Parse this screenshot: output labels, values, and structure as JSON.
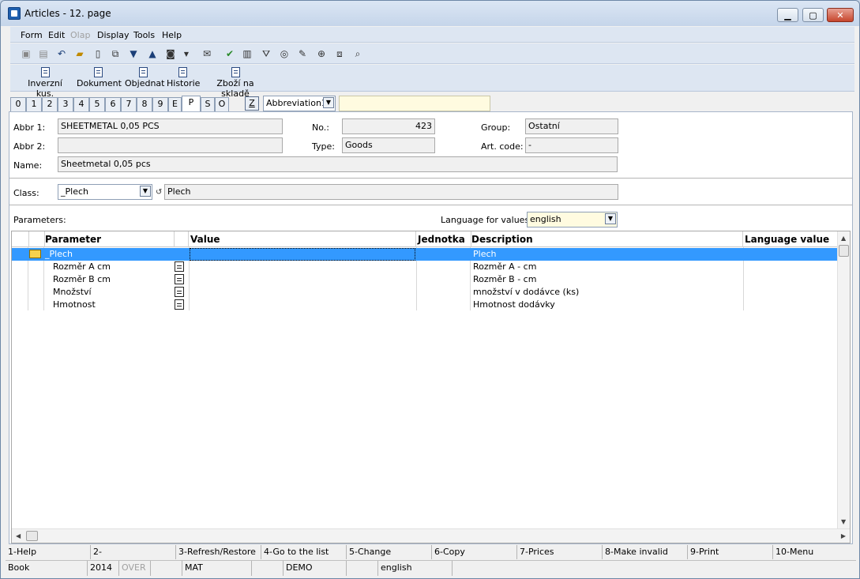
{
  "window": {
    "title": "Articles - 12. page"
  },
  "menu": [
    "Form",
    "Edit",
    "Olap",
    "Display",
    "Tools",
    "Help"
  ],
  "menu_disabled": [
    "Olap"
  ],
  "toolbar_buttons": [
    "Inverzní kus.",
    "Dokument",
    "Objednat",
    "Historie",
    "Zboží na skladě"
  ],
  "tabs": [
    "0",
    "1",
    "2",
    "3",
    "4",
    "5",
    "6",
    "7",
    "8",
    "9",
    "E",
    "P",
    "S",
    "O"
  ],
  "active_tab": "P",
  "sort": {
    "z_label": "Z",
    "field": "Abbreviation1",
    "search_value": ""
  },
  "form": {
    "abbr1_label": "Abbr 1:",
    "abbr1_value": "SHEETMETAL 0,05 PCS",
    "abbr2_label": "Abbr 2:",
    "abbr2_value": "",
    "name_label": "Name:",
    "name_value": "Sheetmetal 0,05 pcs",
    "no_label": "No.:",
    "no_value": "423",
    "type_label": "Type:",
    "type_value": "Goods",
    "group_label": "Group:",
    "group_value": "Ostatní",
    "artcode_label": "Art. code:",
    "artcode_value": "-",
    "class_label": "Class:",
    "class_value": "_Plech",
    "class_desc": "Plech",
    "parameters_label": "Parameters:",
    "lang_label": "Language for values:",
    "lang_value": "english"
  },
  "grid": {
    "columns": [
      "Parameter",
      "Value",
      "Jednotka",
      "Description",
      "Language value"
    ],
    "rows": [
      {
        "parameter": "_Plech",
        "value": "",
        "unit": "",
        "description": "Plech",
        "lang_value": "",
        "type": "folder"
      },
      {
        "parameter": "Rozměr A cm",
        "value": "",
        "unit": "",
        "description": "Rozměr A - cm",
        "lang_value": "",
        "type": "param"
      },
      {
        "parameter": "Rozměr B cm",
        "value": "",
        "unit": "",
        "description": "Rozměr B - cm",
        "lang_value": "",
        "type": "param"
      },
      {
        "parameter": "Množství",
        "value": "",
        "unit": "",
        "description": "množství v dodávce (ks)",
        "lang_value": "",
        "type": "param"
      },
      {
        "parameter": "Hmotnost",
        "value": "",
        "unit": "",
        "description": "Hmotnost dodávky",
        "lang_value": "",
        "type": "param"
      }
    ]
  },
  "fkeys": [
    "1-Help",
    "2-",
    "3-Refresh/Restore",
    "4-Go to the list",
    "5-Change",
    "6-Copy",
    "7-Prices",
    "8-Make invalid",
    "9-Print",
    "10-Menu"
  ],
  "status": {
    "module": "Book",
    "year": "2014",
    "mode": "OVER",
    "user": "MAT",
    "db": "DEMO",
    "lang": "english"
  },
  "colors": {
    "selection": "#3399ff",
    "search_bg": "#fffbe0",
    "accent": "#1f5fae"
  }
}
